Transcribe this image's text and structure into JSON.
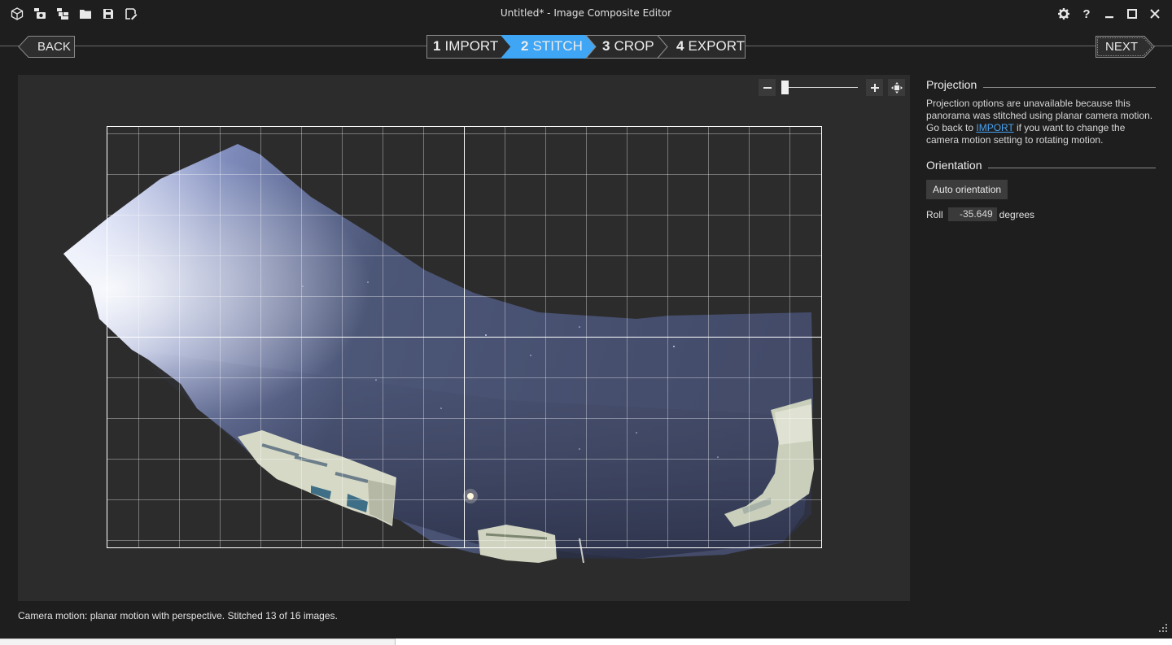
{
  "window": {
    "title": "Untitled* - Image Composite Editor"
  },
  "toolbar": {
    "icons": [
      "new-panorama-icon",
      "new-from-video-icon",
      "new-from-images-icon",
      "open-folder-icon",
      "save-icon",
      "save-as-icon"
    ],
    "right_icons": [
      "settings-gear-icon",
      "help-icon",
      "minimize-icon",
      "maximize-icon",
      "close-icon"
    ],
    "help_glyph": "?"
  },
  "nav": {
    "back_label": "BACK",
    "next_label": "NEXT"
  },
  "steps": [
    {
      "number": "1",
      "label": "IMPORT",
      "active": false
    },
    {
      "number": "2",
      "label": "STITCH",
      "active": true
    },
    {
      "number": "3",
      "label": "CROP",
      "active": false
    },
    {
      "number": "4",
      "label": "EXPORT",
      "active": false
    }
  ],
  "zoom": {
    "level": 0.0
  },
  "panel": {
    "projection": {
      "title": "Projection",
      "text_before": "Projection options are unavailable because this panorama was stitched using planar camera motion. Go back to ",
      "link": "IMPORT",
      "text_after": " if you want to change the camera motion setting to rotating motion."
    },
    "orientation": {
      "title": "Orientation",
      "auto_button": "Auto orientation",
      "roll_label": "Roll",
      "roll_value": "-35.649",
      "roll_unit": "degrees"
    }
  },
  "status": "Camera motion: planar motion with perspective. Stitched 13 of 16 images.",
  "colors": {
    "accent": "#3ea6f4",
    "background": "#1e1e1e",
    "preview": "#2c2c2c",
    "link": "#4aa3f0"
  }
}
